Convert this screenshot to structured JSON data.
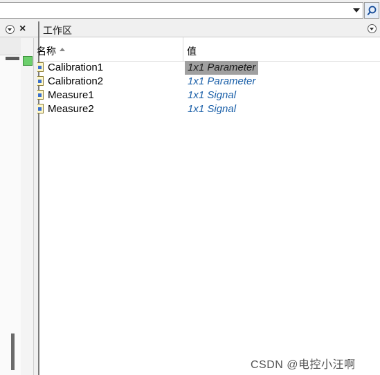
{
  "toolbar": {
    "search_value": "",
    "dropdown_icon": "chevron-down-icon",
    "search_icon": "search-icon"
  },
  "left_panel": {
    "menu_icon": "panel-menu-icon",
    "close_label": "×"
  },
  "workspace": {
    "title": "工作区",
    "columns": {
      "name": "名称",
      "value": "值",
      "sort": "ascending"
    },
    "variables": [
      {
        "name": "Calibration1",
        "value": "1x1 Parameter",
        "selected": true
      },
      {
        "name": "Calibration2",
        "value": "1x1 Parameter",
        "selected": false
      },
      {
        "name": "Measure1",
        "value": "1x1 Signal",
        "selected": false
      },
      {
        "name": "Measure2",
        "value": "1x1 Signal",
        "selected": false
      }
    ]
  },
  "watermark": "CSDN @电控小汪啊",
  "colors": {
    "value_text": "#1a5fa8",
    "selection": "#a0a0a0",
    "status_green": "#6ccf6c"
  }
}
